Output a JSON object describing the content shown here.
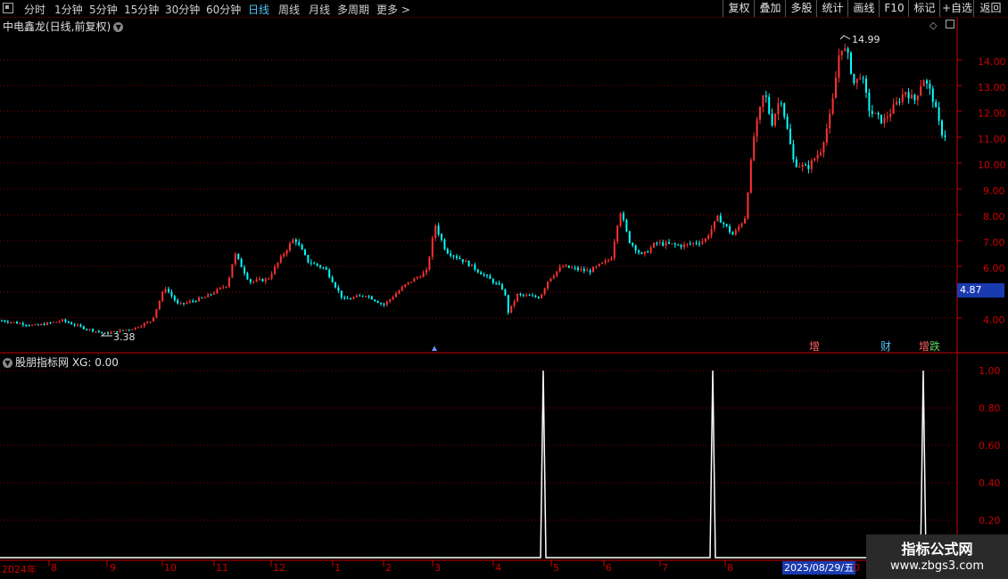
{
  "toolbar": {
    "periods": [
      "分时",
      "1分钟",
      "5分钟",
      "15分钟",
      "30分钟",
      "60分钟",
      "日线",
      "周线",
      "月线",
      "多周期",
      "更多 >"
    ],
    "active": "日线",
    "right_buttons": [
      "复权",
      "叠加",
      "多股",
      "统计",
      "画线",
      "F10",
      "标记",
      "+自选",
      "返回"
    ]
  },
  "main": {
    "title": "中电鑫龙(日线,前复权)",
    "high_label": "14.99",
    "low_label": "3.38",
    "current_price": "4.87",
    "yticks": [
      "14.00",
      "13.00",
      "12.00",
      "11.00",
      "10.00",
      "9.00",
      "8.00",
      "7.00",
      "6.00",
      "4.00"
    ],
    "markers": [
      {
        "text": "增",
        "color": "#ff6060"
      },
      {
        "text": "财",
        "color": "#4fc3f7"
      },
      {
        "text": "跌",
        "color": "#60d060"
      }
    ]
  },
  "sub": {
    "title": "股朋指标网 XG: 0.00",
    "yticks": [
      "1.00",
      "0.80",
      "0.60",
      "0.40",
      "0.20"
    ]
  },
  "xaxis": {
    "labels": [
      "2024年",
      "8",
      "9",
      "10",
      "11",
      "12",
      "1",
      "2",
      "3",
      "4",
      "5",
      "6",
      "7",
      "8",
      "0"
    ],
    "date": "2025/08/29/五"
  },
  "watermark": {
    "line1": "指标公式网",
    "line2": "www.zbgs3.com"
  },
  "colors": {
    "up": "#ff3232",
    "down": "#00ffff",
    "grid": "#8b0000",
    "axis": "#c80000"
  },
  "chart_data": [
    {
      "type": "candlestick",
      "title": "中电鑫龙(日线,前复权)",
      "ylim": [
        3.0,
        15.0
      ],
      "notable": {
        "high": 14.99,
        "low": 3.38,
        "last": 4.87
      },
      "monthly_closes": [
        {
          "x": "2024-07",
          "y": 3.7
        },
        {
          "x": "2024-08",
          "y": 3.6
        },
        {
          "x": "2024-09",
          "y": 4.6
        },
        {
          "x": "2024-10",
          "y": 5.4
        },
        {
          "x": "2024-11",
          "y": 6.4
        },
        {
          "x": "2024-12",
          "y": 5.0
        },
        {
          "x": "2025-01",
          "y": 5.1
        },
        {
          "x": "2025-02",
          "y": 6.3
        },
        {
          "x": "2025-03",
          "y": 5.4
        },
        {
          "x": "2025-04",
          "y": 4.7
        },
        {
          "x": "2025-05",
          "y": 5.9
        },
        {
          "x": "2025-06",
          "y": 6.8
        },
        {
          "x": "2025-07",
          "y": 7.2
        },
        {
          "x": "2025-08",
          "y": 12.5
        }
      ]
    },
    {
      "type": "line",
      "title": "股朋指标网 XG",
      "ylim": [
        0,
        1.05
      ],
      "signals": [
        {
          "x": "2025-04-30",
          "y": 1.0
        },
        {
          "x": "2025-07-25",
          "y": 1.0
        },
        {
          "x": "2025-08-25",
          "y": 1.0
        }
      ]
    }
  ]
}
